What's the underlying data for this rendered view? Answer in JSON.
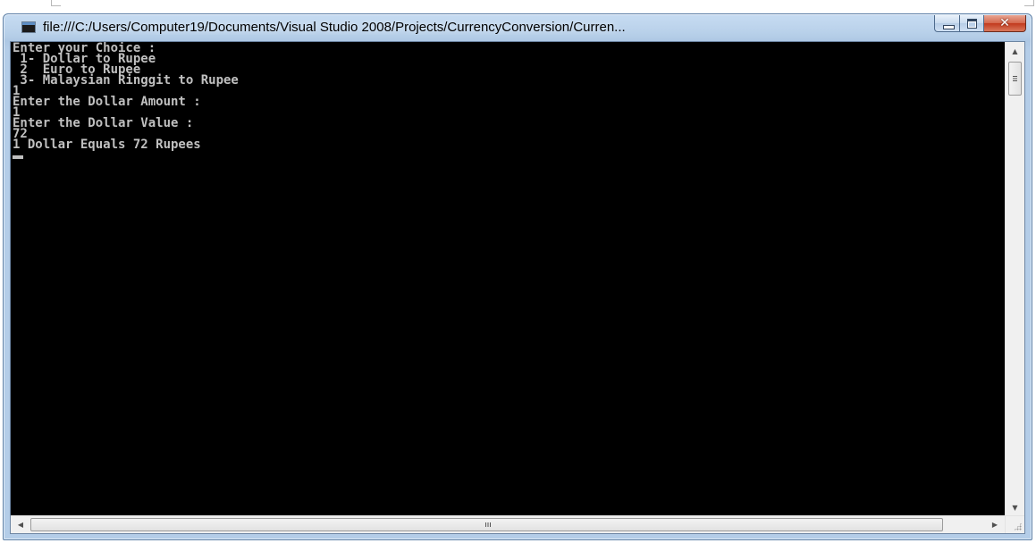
{
  "window": {
    "title": "file:///C:/Users/Computer19/Documents/Visual Studio 2008/Projects/CurrencyConversion/Curren...",
    "icon": "console-window-icon",
    "controls": {
      "minimize": "minimize-icon",
      "maximize": "maximize-icon",
      "close_glyph": "✕"
    }
  },
  "console": {
    "lines": [
      "Enter your Choice :",
      " 1- Dollar to Rupee",
      " 2  Euro to Rupee",
      " 3- Malaysian Ringgit to Rupee",
      "1",
      "Enter the Dollar Amount :",
      "1",
      "Enter the Dollar Value :",
      "72",
      "1 Dollar Equals 72 Rupees"
    ],
    "foreground": "#c0c0c0",
    "background": "#000000"
  },
  "scrollbars": {
    "vertical": {
      "up": "▲",
      "down": "▼"
    },
    "horizontal": {
      "left": "◀",
      "right": "▶"
    }
  }
}
